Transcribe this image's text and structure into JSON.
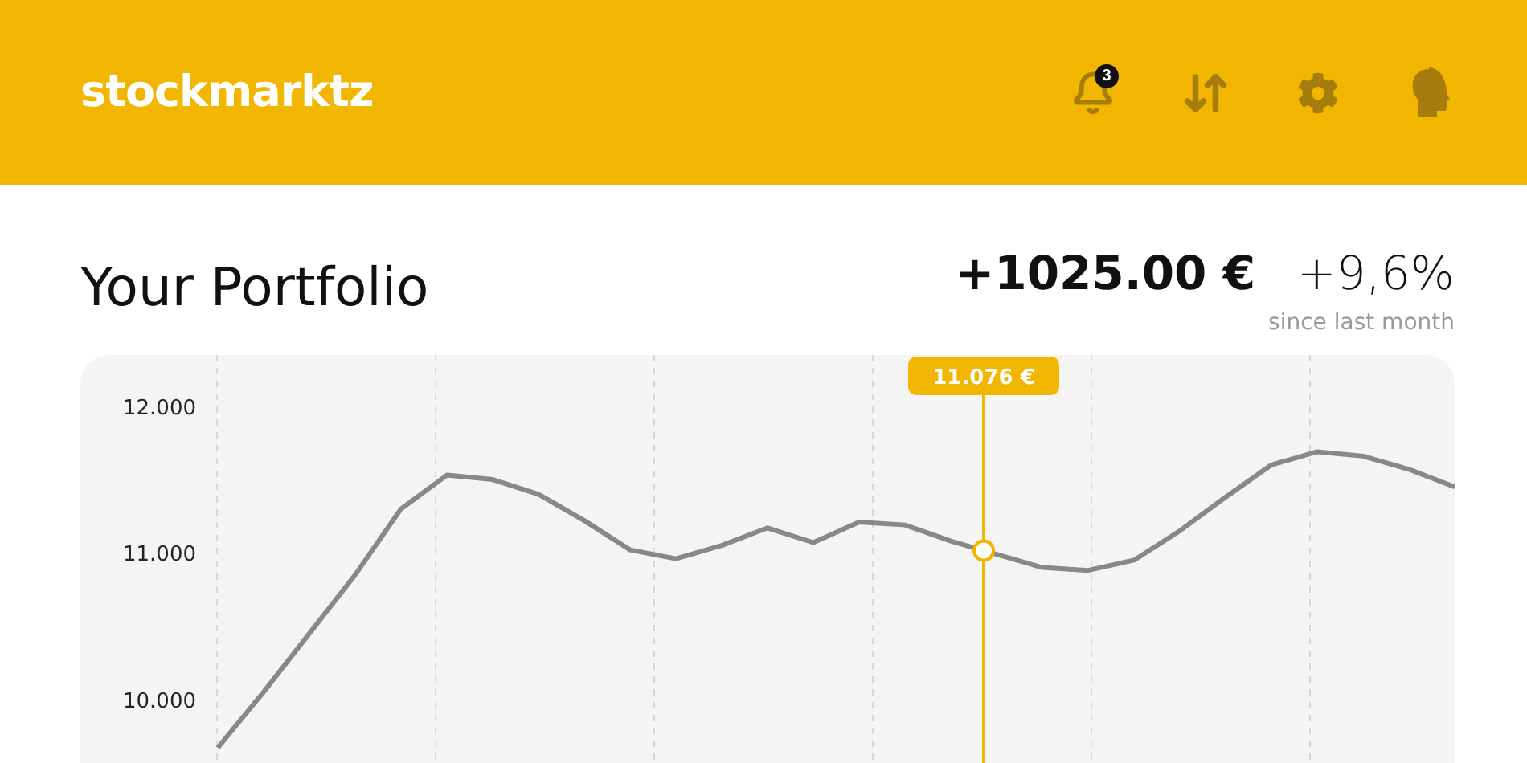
{
  "header": {
    "logo": "stockmarktz",
    "notification_count": "3"
  },
  "portfolio": {
    "title": "Your Portfolio",
    "change_amount": "+1025.00 €",
    "change_percent": "+9,6%",
    "period": "since last month",
    "chart_data": {
      "type": "line",
      "categories": [
        null,
        null,
        null,
        null,
        null,
        null,
        null,
        null,
        null,
        null,
        null,
        null,
        null,
        null,
        null,
        null,
        null,
        null,
        null,
        null,
        null,
        null,
        null,
        null,
        null,
        null,
        null,
        null,
        null,
        null,
        null
      ],
      "series": [
        {
          "color": "#888888",
          "values": [
            null,
            null,
            null,
            9.67,
            10.05,
            10.45,
            10.85,
            11.3,
            11.53,
            11.5,
            11.4,
            11.22,
            11.02,
            10.96,
            11.05,
            11.17,
            11.07,
            11.21,
            11.19,
            11.08,
            10.99,
            10.9,
            10.88,
            10.95,
            11.15,
            11.38,
            11.6,
            11.69,
            11.66,
            11.57,
            11.45
          ]
        }
      ],
      "ylim": [
        9.39,
        12.35
      ],
      "yticks": [
        {
          "value": 10,
          "label": "10.000"
        },
        {
          "value": 11,
          "label": "11.000"
        },
        {
          "value": 12,
          "label": "12.000"
        }
      ]
    },
    "tooltip": {
      "label": "11.076 €"
    }
  }
}
